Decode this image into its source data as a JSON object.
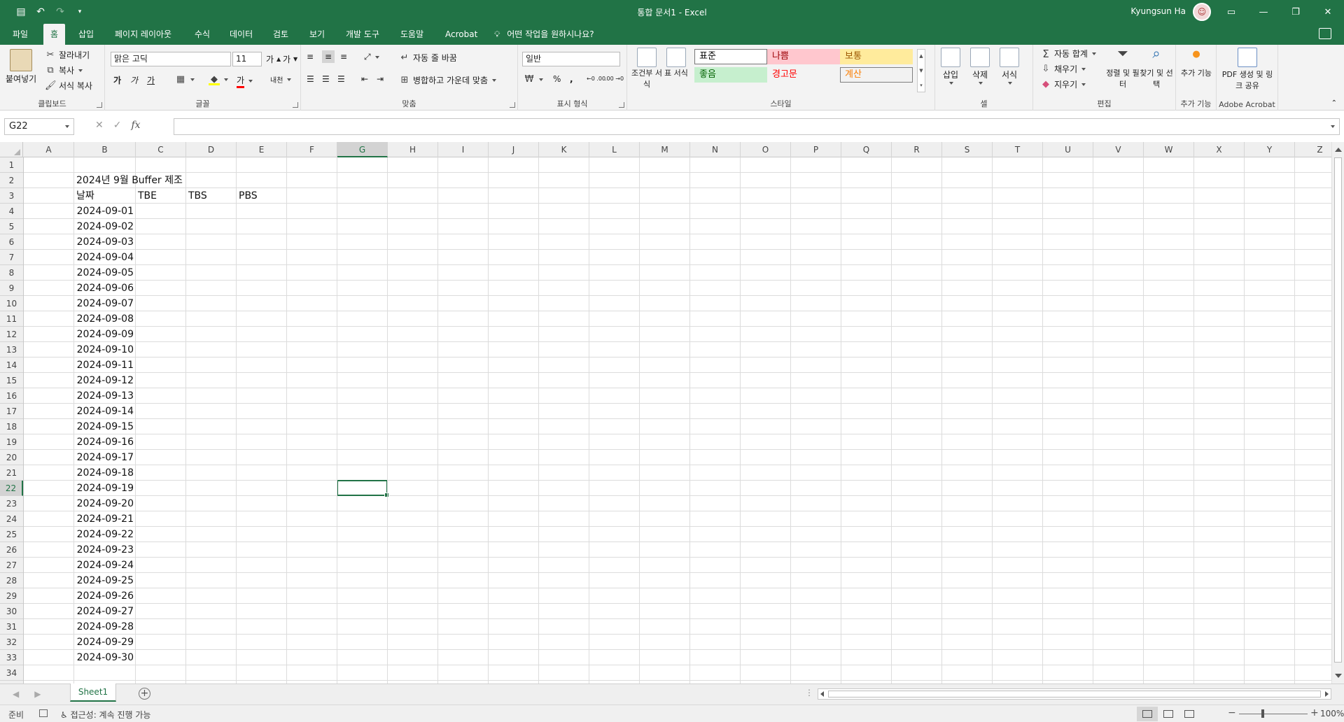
{
  "titlebar": {
    "title": "통합 문서1  -  Excel",
    "user": "Kyungsun Ha",
    "qat": {
      "save_icon": "save-icon",
      "undo_icon": "undo-icon",
      "redo_icon": "redo-icon",
      "customize_icon": "customize-icon"
    }
  },
  "tabs": {
    "items": [
      "파일",
      "홈",
      "삽입",
      "페이지 레이아웃",
      "수식",
      "데이터",
      "검토",
      "보기",
      "개발 도구",
      "도움말",
      "Acrobat"
    ],
    "active": "홈",
    "tell_me": "어떤 작업을 원하시나요?"
  },
  "ribbon": {
    "clipboard": {
      "label": "클립보드",
      "paste": "붙여넣기",
      "cut": "잘라내기",
      "copy": "복사",
      "format_painter": "서식 복사"
    },
    "font": {
      "label": "글꼴",
      "font_name": "맑은 고딕",
      "font_size": "11",
      "bold": "가",
      "italic": "가",
      "underline": "가",
      "font_color_glyph": "가",
      "phonetic": "내천"
    },
    "alignment": {
      "label": "맞춤",
      "wrap_text": "자동 줄 바꿈",
      "merge_center": "병합하고 가운데 맞춤"
    },
    "number": {
      "label": "표시 형식",
      "format": "일반",
      "percent": "%",
      "comma": ",",
      "inc_decimal": "←0 .00",
      "dec_decimal": ".00 →0"
    },
    "styles": {
      "label": "스타일",
      "conditional": "조건부 서식",
      "table": "표 서식",
      "cells": [
        {
          "name": "표준",
          "bg": "#ffffff",
          "fg": "#000000",
          "border": "#777777"
        },
        {
          "name": "나쁨",
          "bg": "#ffc7ce",
          "fg": "#9c0006",
          "border": "#ffc7ce"
        },
        {
          "name": "보통",
          "bg": "#ffeb9c",
          "fg": "#9c5700",
          "border": "#ffeb9c"
        },
        {
          "name": "좋음",
          "bg": "#c6efce",
          "fg": "#006100",
          "border": "#c6efce"
        },
        {
          "name": "경고문",
          "bg": "#f3f3f3",
          "fg": "#ff0000",
          "border": "#f3f3f3"
        },
        {
          "name": "계산",
          "bg": "#f2f2f2",
          "fg": "#fa7d00",
          "border": "#7f7f7f"
        }
      ]
    },
    "cells": {
      "label": "셀",
      "insert": "삽입",
      "delete": "삭제",
      "format": "서식"
    },
    "editing": {
      "label": "편집",
      "autosum": "자동 합계",
      "fill": "채우기",
      "clear": "지우기",
      "sort_filter": "정렬 및 필터",
      "find_select": "찾기 및 선택"
    },
    "addins": {
      "label": "추가 기능",
      "button": "추가 기능"
    },
    "acrobat": {
      "label": "Adobe Acrobat",
      "button": "PDF 생성 및 링크 공유"
    }
  },
  "formula_bar": {
    "name_box": "G22",
    "cancel": "✕",
    "enter": "✓",
    "fx": "fx",
    "value": ""
  },
  "sheet": {
    "columns": [
      "A",
      "B",
      "C",
      "D",
      "E",
      "F",
      "G",
      "H",
      "I",
      "J",
      "K",
      "L",
      "M",
      "N",
      "O",
      "P",
      "Q",
      "R",
      "S",
      "T",
      "U",
      "V",
      "W",
      "X",
      "Y",
      "Z"
    ],
    "rows_count": 34,
    "selected_col": "G",
    "selected_row": 22,
    "title_cell": "2024년 9월 Buffer 제조",
    "headers": [
      "날짜",
      "TBE",
      "TBS",
      "PBS"
    ],
    "dates": [
      "2024-09-01",
      "2024-09-02",
      "2024-09-03",
      "2024-09-04",
      "2024-09-05",
      "2024-09-06",
      "2024-09-07",
      "2024-09-08",
      "2024-09-09",
      "2024-09-10",
      "2024-09-11",
      "2024-09-12",
      "2024-09-13",
      "2024-09-14",
      "2024-09-15",
      "2024-09-16",
      "2024-09-17",
      "2024-09-18",
      "2024-09-19",
      "2024-09-20",
      "2024-09-21",
      "2024-09-22",
      "2024-09-23",
      "2024-09-24",
      "2024-09-25",
      "2024-09-26",
      "2024-09-27",
      "2024-09-28",
      "2024-09-29",
      "2024-09-30"
    ]
  },
  "sheet_tabs": {
    "active": "Sheet1",
    "add": "+"
  },
  "status": {
    "ready": "준비",
    "accessibility": "접근성: 계속 진행 가능",
    "zoom": "100%"
  }
}
